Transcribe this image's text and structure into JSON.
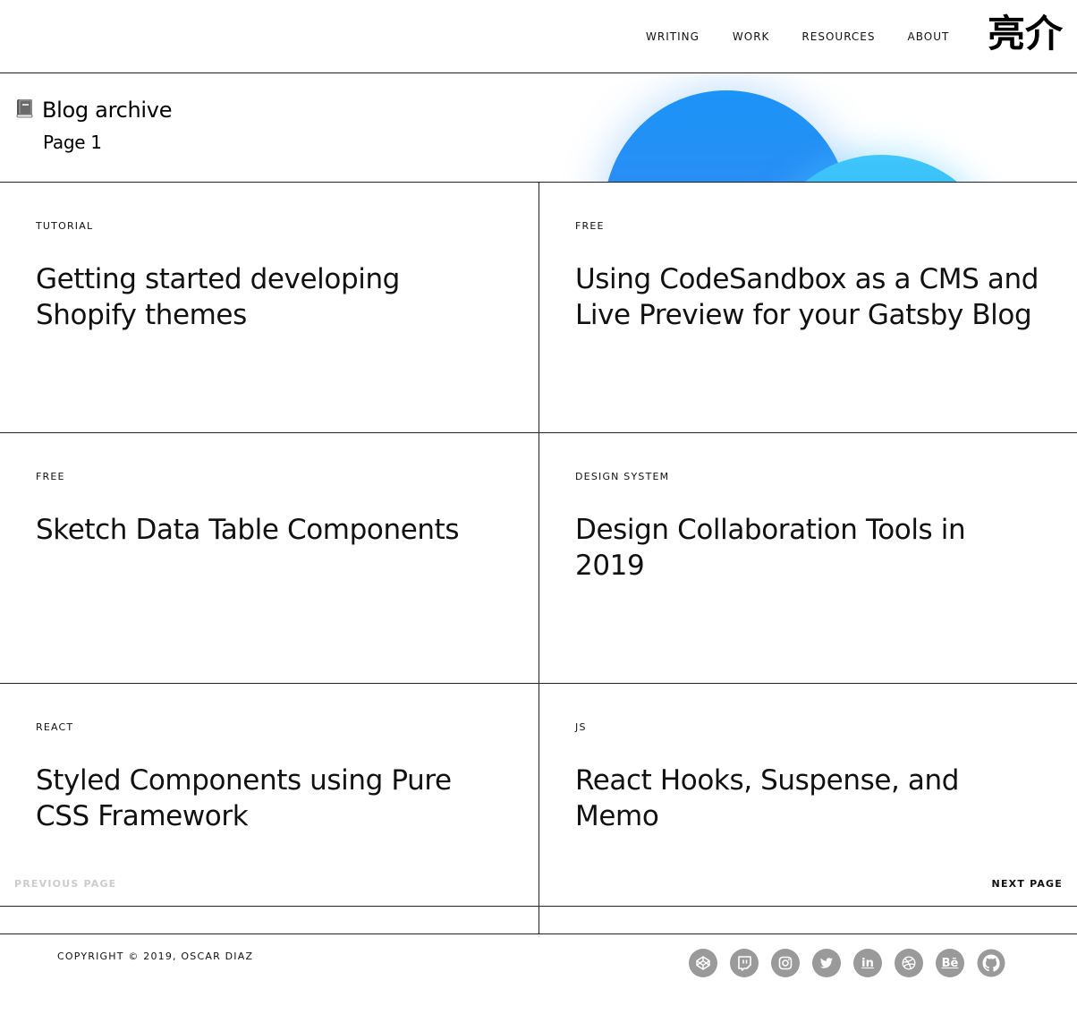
{
  "header": {
    "nav": [
      "WRITING",
      "WORK",
      "RESOURCES",
      "ABOUT"
    ],
    "logo": "亮介"
  },
  "hero": {
    "title": "Blog archive",
    "page": "Page 1",
    "icon": "book-icon"
  },
  "posts": [
    {
      "tag": "TUTORIAL",
      "title": "Getting started developing Shopify themes"
    },
    {
      "tag": "FREE",
      "title": "Using CodeSandbox as a CMS and Live Preview for your Gatsby Blog"
    },
    {
      "tag": "FREE",
      "title": "Sketch Data Table Components"
    },
    {
      "tag": "DESIGN SYSTEM",
      "title": "Design Collaboration Tools in 2019"
    },
    {
      "tag": "REACT",
      "title": "Styled Components using Pure CSS Framework"
    },
    {
      "tag": "JS",
      "title": "React Hooks, Suspense, and Memo"
    }
  ],
  "pager": {
    "previous": "PREVIOUS PAGE",
    "next": "NEXT PAGE"
  },
  "footer": {
    "copyright": "COPYRIGHT © 2019, OSCAR DIAZ",
    "socials": [
      "codepen-icon",
      "twitch-icon",
      "instagram-icon",
      "twitter-icon",
      "linkedin-icon",
      "dribbble-icon",
      "behance-icon",
      "github-icon"
    ],
    "linkedin_text": "in",
    "behance_text": "Bē"
  },
  "colors": {
    "blob_primary": "#2f8cf5",
    "blob_secondary": "#3fc6fb",
    "social_bg": "#9a9a9a",
    "disabled": "#cccccc"
  }
}
